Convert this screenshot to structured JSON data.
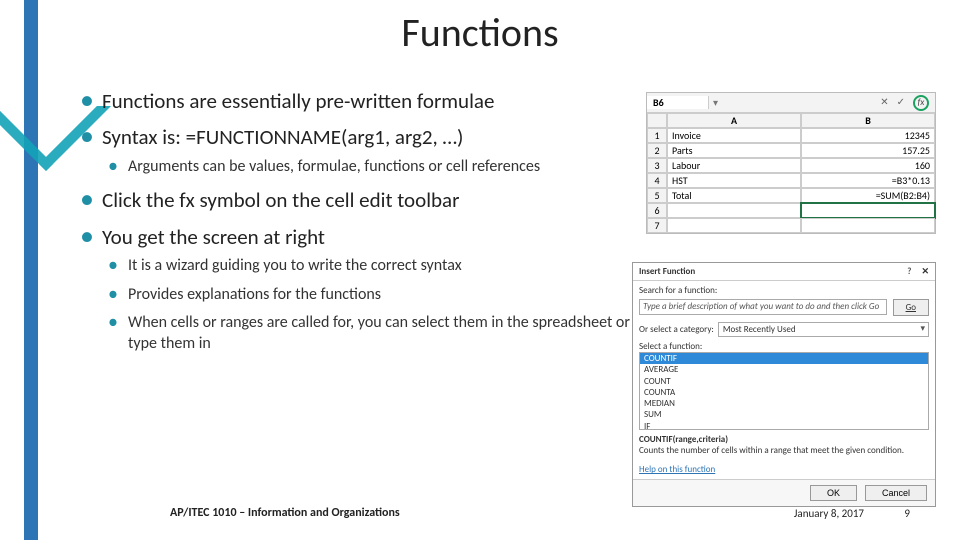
{
  "title": "Functions",
  "bullets": {
    "b1": "Functions are essentially pre-written formulae",
    "b2": "Syntax is: =FUNCTIONNAME(arg1, arg2, …)",
    "b2a": "Arguments can be values, formulae, functions or cell references",
    "b3": "Click the fx symbol on the cell edit toolbar",
    "b4": "You get the screen at right",
    "b4a": "It is a wizard guiding you to write the correct syntax",
    "b4b": "Provides explanations for the functions",
    "b4c": "When cells or ranges are called for, you can select them in the spreadsheet or type them in"
  },
  "footer": {
    "course": "AP/ITEC 1010 – Information and Organizations",
    "date": "January 8, 2017",
    "page": "9"
  },
  "sheet": {
    "namebox": "B6",
    "colA": "A",
    "colB": "B",
    "rows": [
      {
        "n": "1",
        "a": "Invoice",
        "b": "12345"
      },
      {
        "n": "2",
        "a": "Parts",
        "b": "157.25"
      },
      {
        "n": "3",
        "a": "Labour",
        "b": "160"
      },
      {
        "n": "4",
        "a": "HST",
        "b": "=B3*0.13"
      },
      {
        "n": "5",
        "a": "Total",
        "b": "=SUM(B2:B4)"
      },
      {
        "n": "6",
        "a": "",
        "b": ""
      },
      {
        "n": "7",
        "a": "",
        "b": ""
      }
    ],
    "fx_label": "fx",
    "check": "✓",
    "ex": "✕",
    "dd": "▾"
  },
  "dialog": {
    "title": "Insert Function",
    "help_q": "?",
    "close": "✕",
    "search_label": "Search for a function:",
    "search_text": "Type a brief description of what you want to do and then click Go",
    "go": "Go",
    "cat_label": "Or select a category:",
    "cat_value": "Most Recently Used",
    "select_label": "Select a function:",
    "funcs": [
      "COUNTIF",
      "AVERAGE",
      "COUNT",
      "COUNTA",
      "MEDIAN",
      "SUM",
      "IF"
    ],
    "sig": "COUNTIF(range,criteria)",
    "desc": "Counts the number of cells within a range that meet the given condition.",
    "help": "Help on this function",
    "ok": "OK",
    "cancel": "Cancel"
  }
}
